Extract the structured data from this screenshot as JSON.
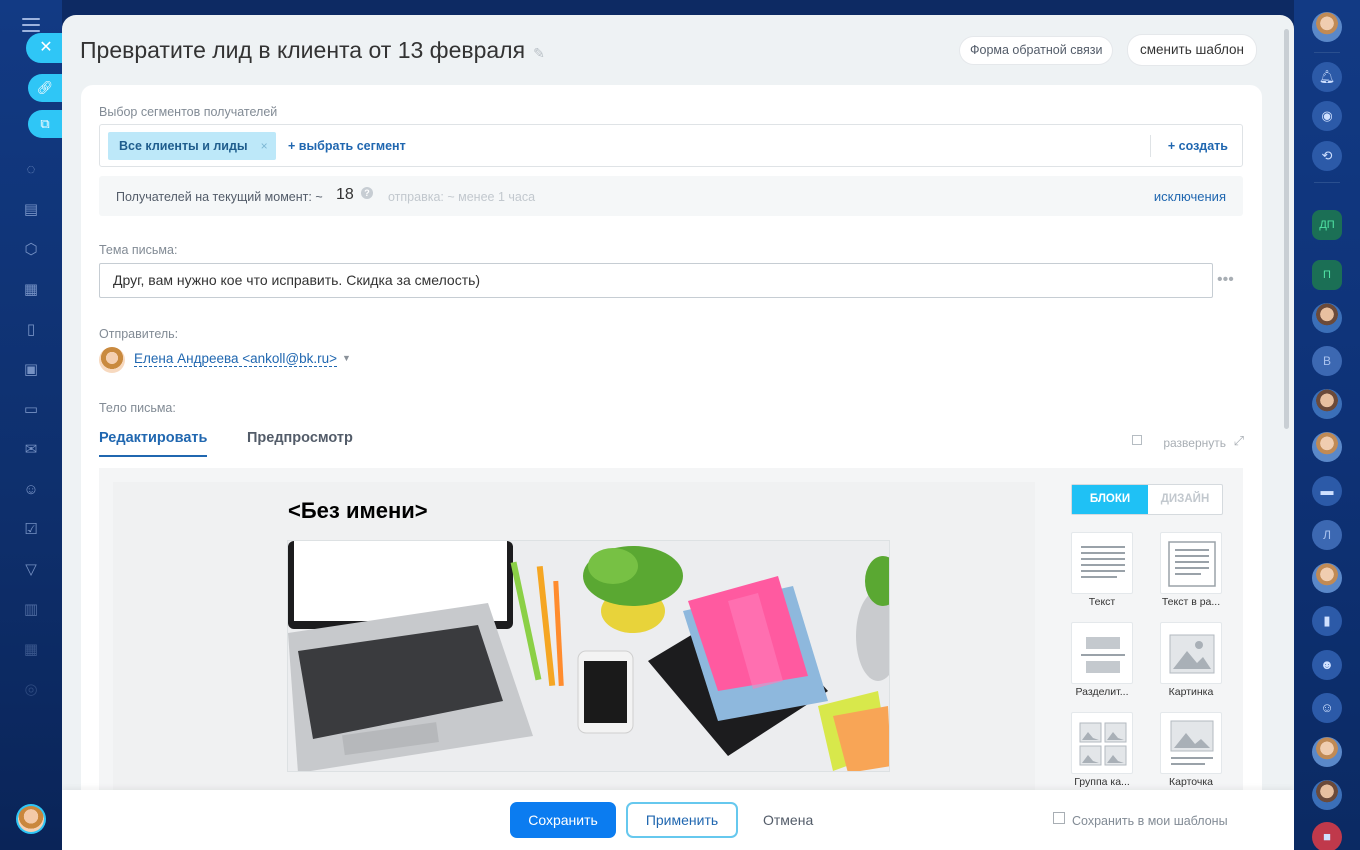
{
  "header": {
    "title": "Превратите лид в клиента от 13 февраля",
    "feedback_button": "Форма обратной связи",
    "switch_template_button": "сменить шаблон"
  },
  "segments": {
    "label": "Выбор сегментов получателей",
    "selected_tag": "Все клиенты и лиды",
    "tag_remove": "×",
    "add_segment": "+ выбрать сегмент",
    "create": "+ создать"
  },
  "recipients": {
    "label": "Получателей на текущий момент: ~",
    "count": "18",
    "help": "?",
    "eta": "отправка: ~ менее 1 часа",
    "exclusions": "исключения"
  },
  "subject": {
    "label": "Тема письма:",
    "value": "Друг, вам нужно кое что исправить. Скидка за смелость)",
    "more": "•••"
  },
  "sender": {
    "label": "Отправитель:",
    "value": "Елена Андреева <ankoll@bk.ru>"
  },
  "body": {
    "label": "Тело письма:",
    "tab_edit": "Редактировать",
    "tab_preview": "Предпросмотр",
    "expand": "развернуть",
    "mail_title": "<Без имени>",
    "toggle_blocks": "БЛОКИ",
    "toggle_design": "ДИЗАЙН",
    "blocks": [
      "Текст",
      "Текст в ра...",
      "Разделит...",
      "Картинка",
      "Группа ка...",
      "Карточка"
    ]
  },
  "footer": {
    "save": "Сохранить",
    "apply": "Применить",
    "cancel": "Отмена",
    "save_template": "Сохранить в мои шаблоны"
  },
  "right_rail": {
    "letters": [
      "ДП",
      "П",
      "В",
      "Л"
    ]
  },
  "colors": {
    "accent": "#2fc6f6",
    "primary_button": "#0b7cf0",
    "link": "#2067b0"
  }
}
